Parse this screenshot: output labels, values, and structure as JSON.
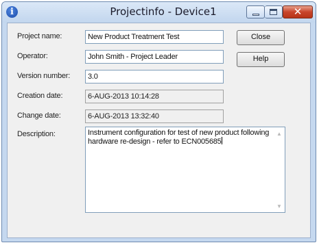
{
  "window": {
    "title": "Projectinfo - Device1",
    "icons": {
      "app": "info-icon",
      "minimize": "minimize-icon",
      "maximize": "maximize-icon",
      "close": "close-icon"
    },
    "app_icon_glyph": "i",
    "close_glyph": "✕",
    "colors": {
      "title_bar": "#c9dbf1",
      "close_button": "#c8452c",
      "client_bg": "#f0f0f0"
    }
  },
  "form": {
    "project_name": {
      "label": "Project name:",
      "value": "New Product Treatment Test"
    },
    "operator": {
      "label": "Operator:",
      "value": "John Smith - Project Leader"
    },
    "version": {
      "label": "Version number:",
      "value": "3.0"
    },
    "creation_date": {
      "label": "Creation date:",
      "value": "6-AUG-2013 10:14:28"
    },
    "change_date": {
      "label": "Change date:",
      "value": "6-AUG-2013 13:32:40"
    },
    "description": {
      "label": "Description:",
      "line1": "Instrument configuration for test of new product following",
      "line2": "hardware re-design - refer to ECN005685"
    }
  },
  "buttons": {
    "close": "Close",
    "help": "Help"
  },
  "scroll": {
    "up_icon": "scroll-up-arrow-icon",
    "down_icon": "scroll-down-arrow-icon",
    "up_glyph": "▲",
    "down_glyph": "▼"
  }
}
